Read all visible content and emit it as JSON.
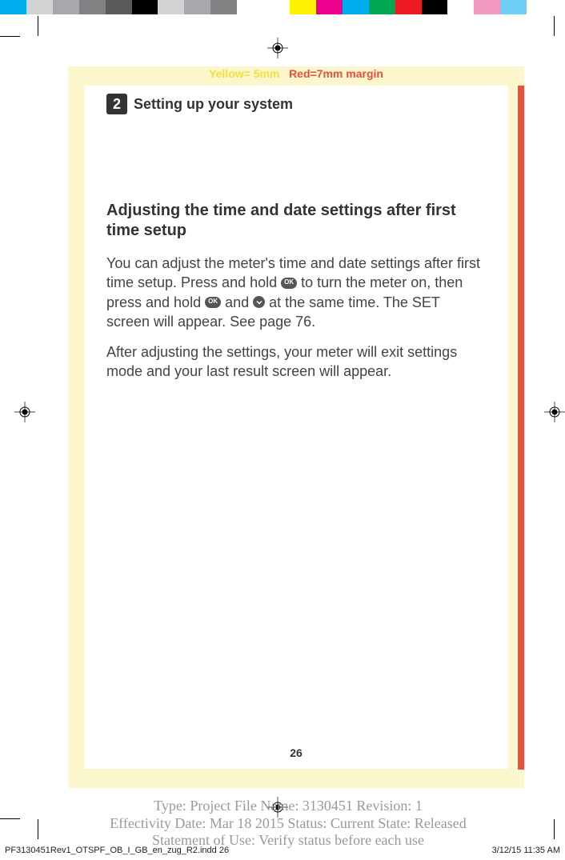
{
  "margin_label_yellow": "Yellow= 5mm",
  "margin_label_red": "Red=7mm margin",
  "chapter_number": "2",
  "section_title": "Setting up your system",
  "subheading": "Adjusting the time and date settings after first time setup",
  "paragraph1_a": "You can adjust the meter's time and date settings after first time setup. Press and hold ",
  "paragraph1_b": " to turn the meter on, then press and hold ",
  "paragraph1_c": " and ",
  "paragraph1_d": " at the same time. The SET screen will appear. See page 76.",
  "paragraph2": "After adjusting the settings, your meter will exit settings mode and your last result screen will appear.",
  "btn_ok": "OK",
  "btn_down_sr": "v",
  "page_number": "26",
  "meta_line1": "Type: Project File  Name: 3130451  Revision: 1",
  "meta_line2": "Effectivity Date: Mar 18 2015     Status: Current     State: Released",
  "meta_line3": "Statement of Use: Verify status before each use",
  "footer_file": "PF3130451Rev1_OTSPF_OB_I_GB_en_zug_R2.indd   26",
  "footer_date": "3/12/15   11:35 AM",
  "color_bar": [
    "#00adef",
    "#d0d2d3",
    "#a6a8ab",
    "#808284",
    "#58595b",
    "#000000",
    "#d0d2d3",
    "#a6a8ab",
    "#808284",
    "#ffffff",
    "#ffffff",
    "#fff100",
    "#ed008c",
    "#00adef",
    "#00a652",
    "#ec1b23",
    "#000000",
    "#ffffff",
    "#f49ac1",
    "#6dcff6"
  ]
}
